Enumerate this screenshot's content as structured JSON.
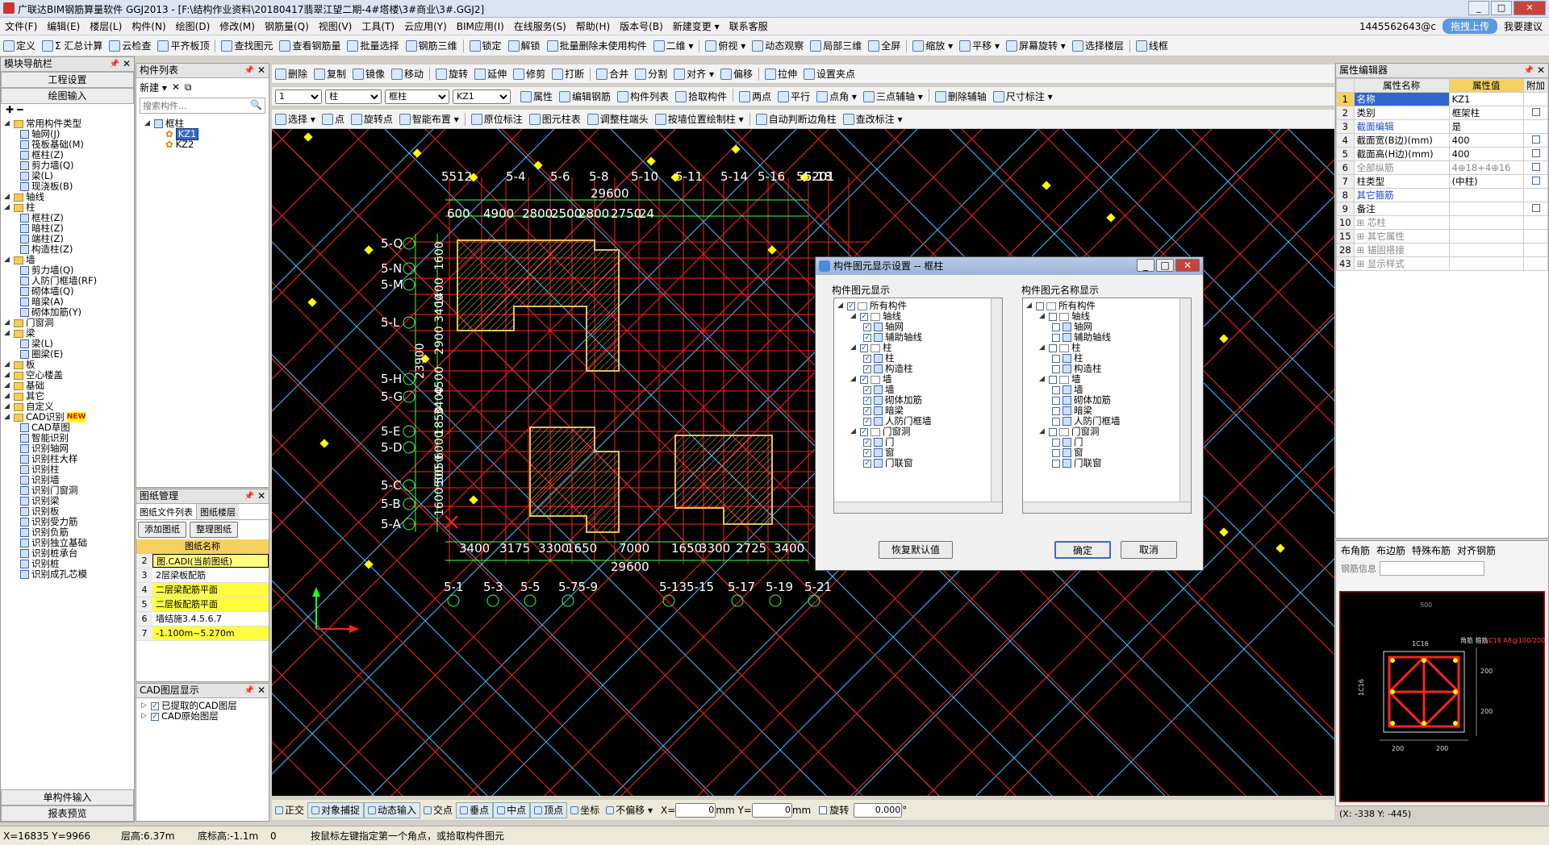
{
  "window": {
    "title": "广联达BIM钢筋算量软件 GGJ2013 - [F:\\结构作业资料\\20180417翡翠江望二期-4#塔楼\\3#商业\\3#.GGJ2]",
    "btn_min": "_",
    "btn_max": "□",
    "btn_close": "✕"
  },
  "menu": [
    "文件(F)",
    "编辑(E)",
    "楼层(L)",
    "构件(N)",
    "绘图(D)",
    "修改(M)",
    "钢筋量(Q)",
    "视图(V)",
    "工具(T)",
    "云应用(Y)",
    "BIM应用(I)",
    "在线服务(S)",
    "帮助(H)",
    "版本号(B)",
    "新建变更 ▾",
    "联系客服"
  ],
  "user": {
    "account": "1445562643@c",
    "upload": "拖拽上传",
    "comment": "我要建议"
  },
  "toolbar1": [
    "定义",
    "Σ 汇总计算",
    "云检查",
    "平齐板顶",
    "查找图元",
    "查看钢筋量",
    "批量选择",
    "钢筋三维",
    "锁定",
    "解锁",
    "批量删除未使用构件",
    "二维 ▾",
    "俯视 ▾",
    "动态观察",
    "局部三维",
    "全屏",
    "缩放 ▾",
    "平移 ▾",
    "屏幕旋转 ▾",
    "选择楼层",
    "线框"
  ],
  "toolbar2": [
    "删除",
    "复制",
    "镜像",
    "移动",
    "旋转",
    "延伸",
    "修剪",
    "打断",
    "合并",
    "分割",
    "对齐 ▾",
    "偏移",
    "拉伸",
    "设置夹点"
  ],
  "toolbar3": {
    "floor": "1",
    "type": "柱",
    "subtype": "框柱",
    "name": "KZ1",
    "items": [
      "属性",
      "编辑钢筋",
      "构件列表",
      "拾取构件",
      "两点",
      "平行",
      "点角 ▾",
      "三点辅轴 ▾",
      "删除辅轴",
      "尺寸标注 ▾"
    ]
  },
  "toolbar4": [
    "选择 ▾",
    "点",
    "旋转点",
    "智能布置 ▾",
    "原位标注",
    "图元柱表",
    "调整柱端头",
    "按墙位置绘制柱 ▾",
    "自动判断边角柱",
    "查改标注 ▾"
  ],
  "nav": {
    "title": "模块导航栏",
    "btn1": "工程设置",
    "btn2": "绘图输入",
    "btn3": "单构件输入",
    "btn4": "报表预览",
    "tree": [
      {
        "d": 0,
        "t": "常用构件类型",
        "f": 1
      },
      {
        "d": 1,
        "t": "轴网(J)"
      },
      {
        "d": 1,
        "t": "筏板基础(M)"
      },
      {
        "d": 1,
        "t": "框柱(Z)"
      },
      {
        "d": 1,
        "t": "剪力墙(Q)"
      },
      {
        "d": 1,
        "t": "梁(L)"
      },
      {
        "d": 1,
        "t": "现浇板(B)"
      },
      {
        "d": 0,
        "t": "轴线",
        "f": 1
      },
      {
        "d": 0,
        "t": "柱",
        "f": 1
      },
      {
        "d": 1,
        "t": "框柱(Z)"
      },
      {
        "d": 1,
        "t": "暗柱(Z)"
      },
      {
        "d": 1,
        "t": "端柱(Z)"
      },
      {
        "d": 1,
        "t": "构造柱(Z)"
      },
      {
        "d": 0,
        "t": "墙",
        "f": 1
      },
      {
        "d": 1,
        "t": "剪力墙(Q)"
      },
      {
        "d": 1,
        "t": "人防门框墙(RF)"
      },
      {
        "d": 1,
        "t": "砌体墙(Q)"
      },
      {
        "d": 1,
        "t": "暗梁(A)"
      },
      {
        "d": 1,
        "t": "砌体加筋(Y)"
      },
      {
        "d": 0,
        "t": "门窗洞",
        "f": 1
      },
      {
        "d": 0,
        "t": "梁",
        "f": 1
      },
      {
        "d": 1,
        "t": "梁(L)"
      },
      {
        "d": 1,
        "t": "圈梁(E)"
      },
      {
        "d": 0,
        "t": "板",
        "f": 1
      },
      {
        "d": 0,
        "t": "空心楼盖",
        "f": 1
      },
      {
        "d": 0,
        "t": "基础",
        "f": 1
      },
      {
        "d": 0,
        "t": "其它",
        "f": 1
      },
      {
        "d": 0,
        "t": "自定义",
        "f": 1
      },
      {
        "d": 0,
        "t": "CAD识别",
        "f": 1,
        "new": "NEW"
      },
      {
        "d": 1,
        "t": "CAD草图"
      },
      {
        "d": 1,
        "t": "智能识别"
      },
      {
        "d": 1,
        "t": "识别轴网"
      },
      {
        "d": 1,
        "t": "识别柱大样"
      },
      {
        "d": 1,
        "t": "识别柱"
      },
      {
        "d": 1,
        "t": "识别墙"
      },
      {
        "d": 1,
        "t": "识别门窗洞"
      },
      {
        "d": 1,
        "t": "识别梁"
      },
      {
        "d": 1,
        "t": "识别板"
      },
      {
        "d": 1,
        "t": "识别受力筋"
      },
      {
        "d": 1,
        "t": "识别负筋"
      },
      {
        "d": 1,
        "t": "识别独立基础"
      },
      {
        "d": 1,
        "t": "识别桩承台"
      },
      {
        "d": 1,
        "t": "识别桩"
      },
      {
        "d": 1,
        "t": "识别成孔芯模"
      }
    ]
  },
  "complist": {
    "title": "构件列表",
    "new": "新建 ▾",
    "search": "搜索构件...",
    "root": "框柱",
    "items": [
      "KZ1",
      "KZ2"
    ]
  },
  "drawing": {
    "title": "图纸管理",
    "tab1": "图纸文件列表",
    "tab2": "图纸楼层",
    "add": "添加图纸",
    "tidy": "整理图纸",
    "col": "图纸名称",
    "rows": [
      {
        "n": "2",
        "t": "图.CADI(当前图纸)"
      },
      {
        "n": "3",
        "t": "2层梁板配筋"
      },
      {
        "n": "4",
        "t": "二层梁配筋平面"
      },
      {
        "n": "5",
        "t": "二层板配筋平面"
      },
      {
        "n": "6",
        "t": "墙结施3.4.5.6.7"
      },
      {
        "n": "7",
        "t": "-1.100m~5.270m"
      }
    ]
  },
  "cadlayer": {
    "title": "CAD图层显示",
    "l1": "已提取的CAD图层",
    "l2": "CAD原始图层"
  },
  "axes_top": [
    "5-1",
    "5-2",
    "5-4",
    "5-6",
    "5-8",
    "5-10",
    "5-11",
    "5-14",
    "5-16",
    "5-18",
    "5-20",
    "5-21"
  ],
  "axes_top_labels": [
    "5512",
    "5-4",
    "5-6",
    "5-8",
    "5-10",
    "5-11",
    "5-14",
    "5-16",
    "5-18",
    "55201"
  ],
  "dims_top_total": "29600",
  "dims_top": [
    "600",
    "4900",
    "2800",
    "2500",
    "2800",
    "2750",
    "24"
  ],
  "axes_left": [
    "5-Q",
    "5-N",
    "5-M",
    "5-L",
    "5-H",
    "5-G",
    "5-E",
    "5-D",
    "5-C",
    "5-B",
    "5-A"
  ],
  "dims_left": [
    "1600",
    "1400",
    "3400",
    "2900",
    "4500",
    "3400",
    "1850",
    "6000",
    "5050",
    "1600500"
  ],
  "dims_left_total": "23900",
  "axes_right": [
    "5-C",
    "5-B",
    "5-A"
  ],
  "dims_bottom": [
    "3400",
    "3175",
    "3300",
    "1650",
    "7000",
    "1650",
    "3300",
    "2725",
    "3400"
  ],
  "dims_bottom_total": "29600",
  "axes_bottom": [
    "5-1",
    "5-3",
    "5-5",
    "5-75-9",
    "5-135-15",
    "5-17",
    "5-19",
    "5-21"
  ],
  "dialog": {
    "title": "构件图元显示设置 -- 框柱",
    "left_title": "构件图元显示",
    "right_title": "构件图元名称显示",
    "items": [
      {
        "d": 0,
        "t": "所有构件"
      },
      {
        "d": 1,
        "t": "轴线"
      },
      {
        "d": 2,
        "t": "轴网"
      },
      {
        "d": 2,
        "t": "辅助轴线"
      },
      {
        "d": 1,
        "t": "柱"
      },
      {
        "d": 2,
        "t": "柱"
      },
      {
        "d": 2,
        "t": "构造柱"
      },
      {
        "d": 1,
        "t": "墙"
      },
      {
        "d": 2,
        "t": "墙"
      },
      {
        "d": 2,
        "t": "砌体加筋"
      },
      {
        "d": 2,
        "t": "暗梁"
      },
      {
        "d": 2,
        "t": "人防门框墙"
      },
      {
        "d": 1,
        "t": "门窗洞"
      },
      {
        "d": 2,
        "t": "门"
      },
      {
        "d": 2,
        "t": "窗"
      },
      {
        "d": 2,
        "t": "门联窗"
      }
    ],
    "restore": "恢复默认值",
    "ok": "确定",
    "cancel": "取消"
  },
  "props": {
    "title": "属性编辑器",
    "col_name": "属性名称",
    "col_val": "属性值",
    "col_add": "附加",
    "rows": [
      {
        "n": "1",
        "k": "名称",
        "v": "KZ1",
        "sel": 1
      },
      {
        "n": "2",
        "k": "类别",
        "v": "框架柱",
        "cb": 1
      },
      {
        "n": "3",
        "k": "截面编辑",
        "v": "是",
        "blue": 1
      },
      {
        "n": "4",
        "k": "截面宽(B边)(mm)",
        "v": "400",
        "cb": 1
      },
      {
        "n": "5",
        "k": "截面高(H边)(mm)",
        "v": "400",
        "cb": 1
      },
      {
        "n": "6",
        "k": "全部纵筋",
        "v": "4⊕18+4⊕16",
        "cb": 1,
        "gray": 1
      },
      {
        "n": "7",
        "k": "柱类型",
        "v": "(中柱)",
        "cb": 1
      },
      {
        "n": "8",
        "k": "其它箍筋",
        "v": "",
        "blue": 1
      },
      {
        "n": "9",
        "k": "备注",
        "v": "",
        "cb": 1
      },
      {
        "n": "10",
        "k": "⊞ 芯柱",
        "v": "",
        "gray": 1
      },
      {
        "n": "15",
        "k": "⊞ 其它属性",
        "v": "",
        "gray": 1
      },
      {
        "n": "28",
        "k": "⊞ 锚固搭接",
        "v": "",
        "gray": 1
      },
      {
        "n": "43",
        "k": "⊞ 显示样式",
        "v": "",
        "gray": 1
      }
    ]
  },
  "rebar": {
    "tabs": [
      "布角筋",
      "布边筋",
      "特殊布筋",
      "对齐钢筋"
    ],
    "info": "钢筋信息",
    "labels": {
      "top": "500",
      "side": "1C16",
      "corner": "角筋 箍筋",
      "corner_val": "1C18 A8@100/200",
      "b1": "200",
      "b2": "200",
      "h1": "200",
      "h2": "200",
      "left": "1C16"
    }
  },
  "coords": "(X: -338 Y: -445)",
  "bottombar": {
    "items": [
      "正交",
      "对象捕捉",
      "动态输入",
      "交点",
      "垂点",
      "中点",
      "顶点",
      "坐标",
      "不偏移 ▾"
    ],
    "x_label": "X=",
    "x_val": "0",
    "y_label": "mm Y=",
    "y_val": "0",
    "unit": "mm",
    "rotate": "旋转",
    "rot_val": "0.000",
    "deg": "°"
  },
  "status": {
    "xy": "X=16835 Y=9966",
    "floor_h": "层高:6.37m",
    "bottom_h": "底标高:-1.1m",
    "zero": "0",
    "hint": "按鼠标左键指定第一个角点，或拾取构件图元"
  },
  "colors": {
    "grid_red": "#ff2020",
    "grid_green": "#20ff20",
    "hatch": "#e0c060",
    "dim_green": "#40ff40",
    "diag_cyan": "#40c0ff",
    "point_yellow": "#ffff00"
  }
}
